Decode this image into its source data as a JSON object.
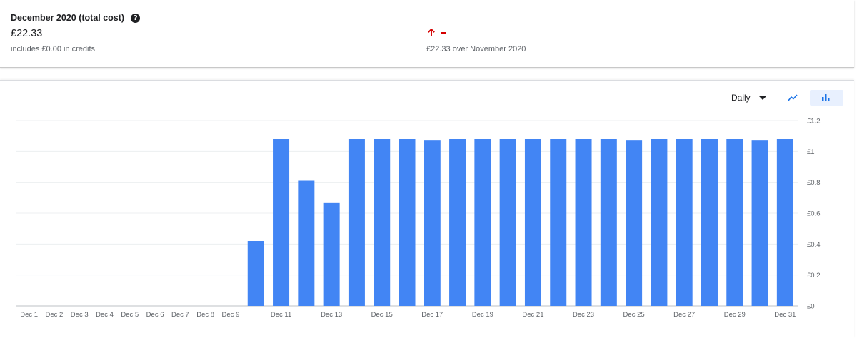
{
  "summary": {
    "title": "December 2020 (total cost)",
    "total": "£22.33",
    "credits_note": "includes £0.00 in credits",
    "trend_icon": "arrow-up-icon",
    "trend_note": "£22.33 over November 2020",
    "trend_color": "#d50000"
  },
  "controls": {
    "granularity": "Daily",
    "line_icon": "line-chart-icon",
    "bar_icon": "bar-chart-icon",
    "active_view": "bar"
  },
  "chart_data": {
    "type": "bar",
    "bar_color": "#4285f4",
    "categories": [
      "Dec 1",
      "Dec 2",
      "Dec 3",
      "Dec 4",
      "Dec 5",
      "Dec 6",
      "Dec 7",
      "Dec 8",
      "Dec 9",
      "Dec 10",
      "Dec 11",
      "Dec 12",
      "Dec 13",
      "Dec 14",
      "Dec 15",
      "Dec 16",
      "Dec 17",
      "Dec 18",
      "Dec 19",
      "Dec 20",
      "Dec 21",
      "Dec 22",
      "Dec 23",
      "Dec 24",
      "Dec 25",
      "Dec 26",
      "Dec 27",
      "Dec 28",
      "Dec 29",
      "Dec 30",
      "Dec 31"
    ],
    "x_tick_labels": [
      "Dec 1",
      "Dec 2",
      "Dec 3",
      "Dec 4",
      "Dec 5",
      "Dec 6",
      "Dec 7",
      "Dec 8",
      "Dec 9",
      "",
      "Dec 11",
      "",
      "Dec 13",
      "",
      "Dec 15",
      "",
      "Dec 17",
      "",
      "Dec 19",
      "",
      "Dec 21",
      "",
      "Dec 23",
      "",
      "Dec 25",
      "",
      "Dec 27",
      "",
      "Dec 29",
      "",
      "Dec 31"
    ],
    "values": [
      0,
      0,
      0,
      0,
      0,
      0,
      0,
      0,
      0,
      0.42,
      1.08,
      0.81,
      0.67,
      1.08,
      1.08,
      1.08,
      1.07,
      1.08,
      1.08,
      1.08,
      1.08,
      1.08,
      1.08,
      1.08,
      1.07,
      1.08,
      1.08,
      1.08,
      1.08,
      1.07,
      1.08
    ],
    "y_ticks": [
      "£0",
      "£0.2",
      "£0.4",
      "£0.6",
      "£0.8",
      "£1",
      "£1.2"
    ],
    "ylim": [
      0,
      1.2
    ],
    "grid": true
  }
}
